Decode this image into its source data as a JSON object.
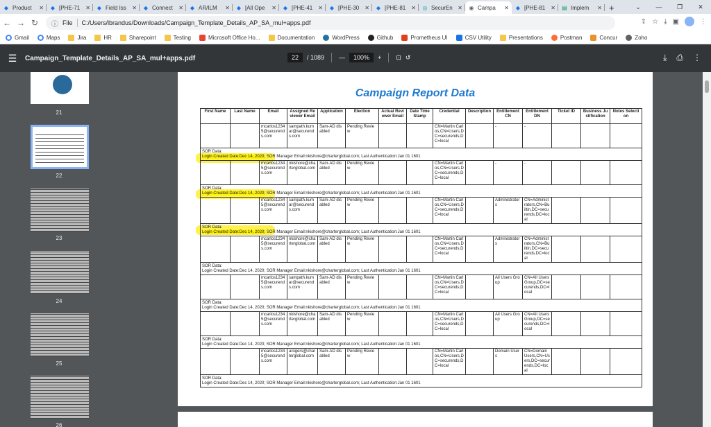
{
  "tabs": [
    {
      "label": "Product",
      "icon": "jira-icon"
    },
    {
      "label": "[PHE-71",
      "icon": "jira-icon"
    },
    {
      "label": "Field Iss",
      "icon": "jira-icon"
    },
    {
      "label": "Connect",
      "icon": "jira-icon"
    },
    {
      "label": "AR/ILM",
      "icon": "jira-icon"
    },
    {
      "label": "[All Ope",
      "icon": "jira-icon"
    },
    {
      "label": "[PHE-41",
      "icon": "jira-icon"
    },
    {
      "label": "[PHE-30",
      "icon": "jira-icon"
    },
    {
      "label": "[PHE-81",
      "icon": "jira-icon"
    },
    {
      "label": "SecurEn",
      "icon": "securen-icon"
    },
    {
      "label": "Campa",
      "icon": "globe-icon",
      "active": true
    },
    {
      "label": "[PHE-81",
      "icon": "jira-icon"
    },
    {
      "label": "Implem",
      "icon": "doc-icon"
    }
  ],
  "address": {
    "scheme": "File",
    "url": "C:/Users/lbrandus/Downloads/Campaign_Template_Details_AP_SA_mul+apps.pdf"
  },
  "bookmarks": [
    "Gmail",
    "Maps",
    "Jira",
    "HR",
    "Sharepoint",
    "Testing",
    "Microsoft Office Ho...",
    "Documentation",
    "WordPress",
    "Github",
    "Prometheus UI",
    "CSV Utility",
    "Presentations",
    "Postman",
    "Concur",
    "Zoho"
  ],
  "pdf": {
    "filename": "Campaign_Template_Details_AP_SA_mul+apps.pdf",
    "page": "22",
    "total": "/ 1089",
    "zoom": "100%"
  },
  "thumbnails": [
    "21",
    "22",
    "23",
    "24",
    "25",
    "26"
  ],
  "report": {
    "title": "Campaign Report Data",
    "headers": [
      "First Name",
      "Last Name",
      "Email",
      "Assigned Reviewer Email",
      "Application",
      "Election",
      "Actual Reviewer Email",
      "Date Time Stamp",
      "Credential",
      "Description",
      "Entitlement CN",
      "Entitlement DN",
      "Ticket ID",
      "Business Justification",
      "Notes Selection"
    ],
    "rows": [
      {
        "email": "mcarlos12345@securends.com",
        "reviewer": "sampath.kumar@securends.com",
        "app": "Sam-AD disabled",
        "election": "Pending Review",
        "credential": "CN=Martin Carlos,CN=Users,DC=securends,DC=local",
        "ecn": "-",
        "edn": "-"
      },
      {
        "email": "mcarlos12345@securends.com",
        "reviewer": "nkishore@charterglobal.com",
        "app": "Sam-AD disabled",
        "election": "Pending Review",
        "credential": "CN=Martin Carlos,CN=Users,DC=securends,DC=local",
        "ecn": "-",
        "edn": "-"
      },
      {
        "email": "mcarlos12345@securends.com",
        "reviewer": "sampath.kumar@securends.com",
        "app": "Sam-AD disabled",
        "election": "Pending Review",
        "credential": "CN=Martin Carlos,CN=Users,DC=securends,DC=local",
        "ecn": "Administrators",
        "edn": "CN=Administrators,CN=Builtin,DC=securends,DC=local"
      },
      {
        "email": "mcarlos12345@securends.com",
        "reviewer": "nkishore@charterglobal.com",
        "app": "Sam-AD disabled",
        "election": "Pending Review",
        "credential": "CN=Martin Carlos,CN=Users,DC=securends,DC=local",
        "ecn": "Administrators",
        "edn": "CN=Administrators,CN=Builtin,DC=securends,DC=local"
      },
      {
        "email": "mcarlos12345@securends.com",
        "reviewer": "sampath.kumar@securends.com",
        "app": "Sam-AD disabled",
        "election": "Pending Review",
        "credential": "CN=Martin Carlos,CN=Users,DC=securends,DC=local",
        "ecn": "All Users Group",
        "edn": "CN=All Users Group,DC=securends,DC=local"
      },
      {
        "email": "mcarlos12345@securends.com",
        "reviewer": "nkishore@charterglobal.com",
        "app": "Sam-AD disabled",
        "election": "Pending Review",
        "credential": "CN=Martin Carlos,CN=Users,DC=securends,DC=local",
        "ecn": "All Users Group",
        "edn": "CN=All Users Group,DC=securends,DC=local"
      },
      {
        "email": "mcarlos12345@securends.com",
        "reviewer": "arogers@charterglobal.com",
        "app": "Sam-AD disabled",
        "election": "Pending Review",
        "credential": "CN=Martin Carlos,CN=Users,DC=securends,DC=local",
        "ecn": "Domain Users",
        "edn": "CN=Domain Users,CN=Users,DC=securends,DC=local"
      }
    ],
    "sor_label": "SOR Data:",
    "sor_login": "Login Created Date:Dec 14, 2020;",
    "sor_rest": " SOR Manager Email:nkishore@charterglobal.com; Last Authentication:Jan 01 1601"
  }
}
